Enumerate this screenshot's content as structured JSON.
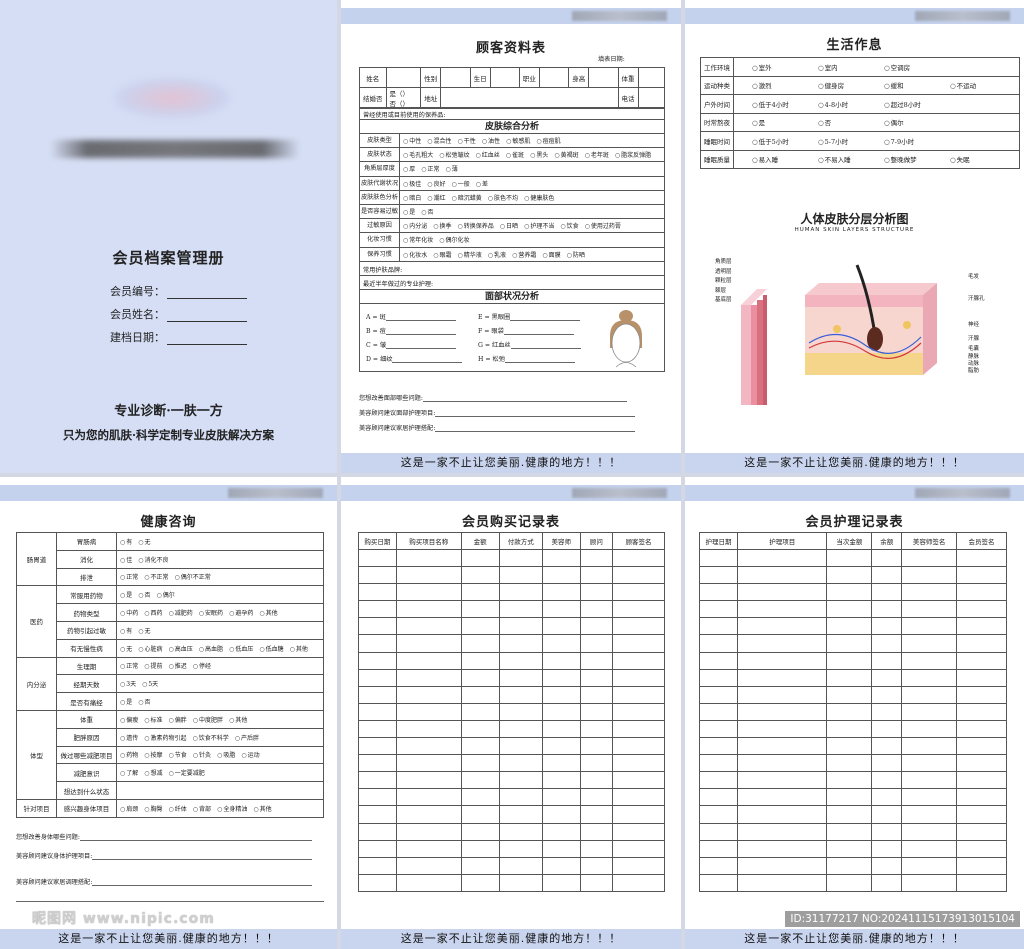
{
  "footer_slogan": "这是一家不止让您美丽.健康的地方！！！",
  "cover": {
    "title": "会员档案管理册",
    "fields": [
      "会员编号：",
      "会员姓名：",
      "建档日期："
    ],
    "slogan1": "专业诊断·一肤一方",
    "slogan2": "只为您的肌肤·科学定制专业皮肤解决方案"
  },
  "customer": {
    "title": "顾客资料表",
    "fill_date": "填表日期:",
    "row1": [
      "姓名",
      "性别",
      "生日",
      "职业",
      "身高",
      "体重"
    ],
    "row2_label1": "结婚否",
    "row2_yes": "是（）",
    "row2_no": "否（）",
    "row2_label2": "地址",
    "row2_label3": "电话",
    "products_label": "曾经使用或目前使用的保养品:",
    "skin_section": "皮肤综合分析",
    "skin_rows": [
      {
        "label": "皮肤类型",
        "options": [
          "中性",
          "混合性",
          "干性",
          "油性",
          "敏感肌",
          "痘痘肌"
        ]
      },
      {
        "label": "皮肤状态",
        "options": [
          "毛孔粗大",
          "松弛皱纹",
          "红血丝",
          "雀斑",
          "黑头",
          "黄褐斑",
          "老年斑",
          "脂浆反弹脂"
        ]
      },
      {
        "label": "角质层厚度",
        "options": [
          "厚",
          "正常",
          "薄"
        ]
      },
      {
        "label": "皮肤代谢状况",
        "options": [
          "极佳",
          "良好",
          "一般",
          "差"
        ]
      },
      {
        "label": "皮肤肤色分析",
        "options": [
          "暗白",
          "潮红",
          "暗沉蜡黄",
          "肤色不均",
          "健康肤色"
        ]
      },
      {
        "label": "是否容易过敏",
        "options": [
          "是",
          "否"
        ]
      },
      {
        "label": "过敏原因",
        "options": [
          "内分泌",
          "换季",
          "转换保养品",
          "日晒",
          "护理不当",
          "饮食",
          "使用过药膏"
        ]
      },
      {
        "label": "化妆习惯",
        "options": [
          "常年化妆",
          "偶尔化妆"
        ]
      },
      {
        "label": "保养习惯",
        "options": [
          "化妆水",
          "眼霜",
          "精华液",
          "乳液",
          "营养霜",
          "面膜",
          "防晒"
        ]
      }
    ],
    "brand_label": "常用护肤品牌:",
    "recent_label": "最近半年做过的专业护理:",
    "face_section": "面部状况分析",
    "face_items": [
      [
        "A = 斑",
        "E = 黑眼圈"
      ],
      [
        "B = 痘",
        "F = 眼袋"
      ],
      [
        "C = 皱",
        "G = 红血丝"
      ],
      [
        "D = 细纹",
        "H = 松弛"
      ]
    ],
    "questions": [
      "您想改善面部哪些问题:",
      "美容顾问建议面部护理项目:",
      "美容顾问建议家居护理搭配:"
    ]
  },
  "lifestyle": {
    "title": "生活作息",
    "rows": [
      {
        "label": "工作环境",
        "options": [
          "室外",
          "室内",
          "空调房"
        ]
      },
      {
        "label": "运动种类",
        "options": [
          "激烈",
          "健身房",
          "缓和",
          "不运动"
        ]
      },
      {
        "label": "户外时间",
        "options": [
          "低于4小时",
          "4-8小时",
          "超过8小时"
        ]
      },
      {
        "label": "时常熬夜",
        "options": [
          "是",
          "否",
          "偶尔"
        ]
      },
      {
        "label": "睡眠时间",
        "options": [
          "低于5小时",
          "5-7小时",
          "7-9小时"
        ]
      },
      {
        "label": "睡眠质量",
        "options": [
          "易入睡",
          "不易入睡",
          "整晚做梦",
          "失眠"
        ]
      }
    ],
    "skin_title": "人体皮肤分层分析图",
    "skin_subtitle": "HUMAN SKIN LAYERS STRUCTURE",
    "left_labels": [
      "角质层",
      "透明层",
      "颗粒层",
      "棘层",
      "基底层"
    ],
    "right_labels": [
      "毛发",
      "汗腺孔",
      "神经",
      "汗腺",
      "毛囊",
      "静脉",
      "动脉",
      "脂肪"
    ]
  },
  "health": {
    "title": "健康咨询",
    "groups": [
      {
        "group": "肠胃道",
        "rows": [
          {
            "label": "胃肠病",
            "options": [
              "有",
              "无"
            ]
          },
          {
            "label": "消化",
            "options": [
              "佳",
              "消化不良"
            ]
          },
          {
            "label": "排泄",
            "options": [
              "正常",
              "不正常",
              "偶尔不正常"
            ]
          }
        ]
      },
      {
        "group": "医药",
        "rows": [
          {
            "label": "常服用药物",
            "options": [
              "是",
              "否",
              "偶尔"
            ]
          },
          {
            "label": "药物类型",
            "options": [
              "中药",
              "西药",
              "减肥药",
              "安眠药",
              "避孕药",
              "其他"
            ]
          },
          {
            "label": "药物引起过敏",
            "options": [
              "有",
              "无"
            ]
          },
          {
            "label": "有无慢性病",
            "options": [
              "无",
              "心脏病",
              "高血压",
              "高血脂",
              "低血压",
              "低血糖",
              "其他"
            ]
          }
        ]
      },
      {
        "group": "内分泌",
        "rows": [
          {
            "label": "生理期",
            "options": [
              "正常",
              "提前",
              "推迟",
              "停经"
            ]
          },
          {
            "label": "经期天数",
            "options": [
              "3天",
              "5天"
            ]
          },
          {
            "label": "是否有痛经",
            "options": [
              "是",
              "否"
            ]
          }
        ]
      },
      {
        "group": "体型",
        "rows": [
          {
            "label": "体重",
            "options": [
              "偏瘦",
              "标准",
              "偏胖",
              "中度肥胖",
              "其他"
            ]
          },
          {
            "label": "肥胖原因",
            "options": [
              "遗传",
              "激素药物引起",
              "饮食不科学",
              "产后胖"
            ]
          },
          {
            "label": "做过哪些减肥项目",
            "options": [
              "药物",
              "按摩",
              "节食",
              "针灸",
              "吸脂",
              "运动"
            ]
          },
          {
            "label": "减肥意识",
            "options": [
              "了解",
              "想减",
              "一定要减肥"
            ]
          },
          {
            "label": "想达到什么状态",
            "options": []
          }
        ]
      },
      {
        "group": "针对项目",
        "rows": [
          {
            "label": "感兴趣身体项目",
            "options": [
              "肩颈",
              "胸臀",
              "纤体",
              "背部",
              "全身精油",
              "其他"
            ]
          }
        ]
      }
    ],
    "questions": [
      "您想改善身体哪些问题:",
      "美容顾问建议身体护理项目:",
      "美容顾问建议家居调理搭配:"
    ]
  },
  "purchase": {
    "title": "会员购买记录表",
    "headers": [
      "购买日期",
      "购买项目名称",
      "金额",
      "付款方式",
      "美容师",
      "顾问",
      "顾客签名"
    ]
  },
  "care": {
    "title": "会员护理记录表",
    "headers": [
      "护理日期",
      "护理项目",
      "当次金额",
      "余额",
      "美容师签名",
      "会员签名"
    ]
  },
  "watermark": {
    "left": "昵图网 www.nipic.com",
    "right": "ID:31177217 NO:20241115173913015104"
  }
}
